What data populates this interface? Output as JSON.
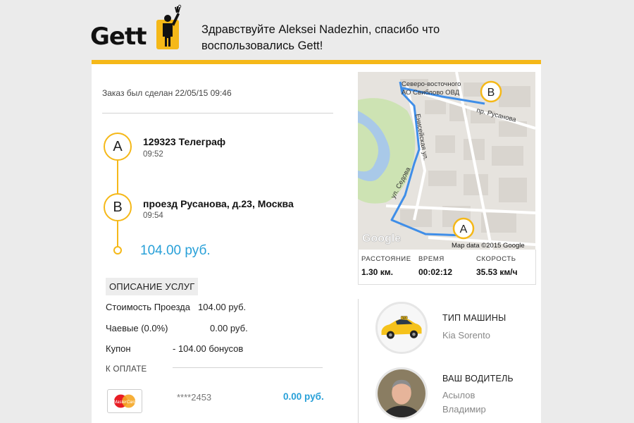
{
  "header": {
    "logo_text": "Gett",
    "greeting_line1": "Здравствуйте Aleksei Nadezhin, спасибо что",
    "greeting_line2": "воспользовались Gett!",
    "accent_color": "#f5b818"
  },
  "order": {
    "date_label": "Заказ был сделан 22/05/15 09:46",
    "point_a": {
      "marker": "A",
      "address": "129323 Телеграф",
      "time": "09:52"
    },
    "point_b": {
      "marker": "B",
      "address": "проезд Русанова, д.23, Москва",
      "time": "09:54"
    },
    "total": "104.00 руб."
  },
  "services": {
    "section_label": "ОПИСАНИЕ УСЛУГ",
    "rows": [
      {
        "label": "Стоимость Проезда",
        "value": "104.00 руб."
      },
      {
        "label": "Чаевые (0.0%)",
        "value": "0.00 руб."
      },
      {
        "label": "Купон",
        "value": "- 104.00 бонусов"
      }
    ],
    "pay_label": "К ОПЛАТЕ",
    "card_brand": "MasterCard",
    "card_number": "****2453",
    "pay_amount": "0.00 руб."
  },
  "map": {
    "labels": {
      "north_east": "Северо-восточного",
      "ovd": "АО Свиблово ОВД",
      "rusanova": "пр. Русанова",
      "yenisei": "Енисейская ул.",
      "sedova": "ул. Седова"
    },
    "marker_a": "A",
    "marker_b": "B",
    "google": "Google",
    "attribution": "Map data ©2015 Google",
    "route_color": "#3f8ee8"
  },
  "stats": [
    {
      "header": "РАССТОЯНИЕ",
      "value": "1.30 км."
    },
    {
      "header": "ВРЕМЯ",
      "value": "00:02:12"
    },
    {
      "header": "СКОРОСТЬ",
      "value": "35.53 км/ч"
    }
  ],
  "car": {
    "header": "ТИП МАШИНЫ",
    "value": "Kia Sorento",
    "taxi_sign": "TAXI"
  },
  "driver": {
    "header": "ВАШ ВОДИТЕЛЬ",
    "name_line1": "Асылов",
    "name_line2": "Владимир"
  }
}
